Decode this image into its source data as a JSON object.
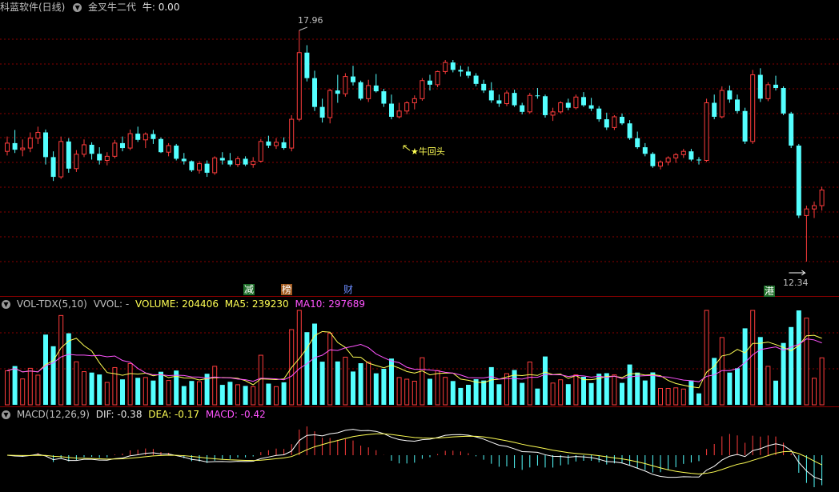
{
  "main_header": {
    "title": "科蓝软件(日线)",
    "indicator": "金叉牛二代",
    "value_text": "牛: 0.00"
  },
  "annotations": {
    "high": "17.96",
    "low": "12.34",
    "signal": "★牛回头"
  },
  "event_tags": [
    {
      "label": "减",
      "color": "#3cb043"
    },
    {
      "label": "榜",
      "color": "#c88040"
    },
    {
      "label": "财",
      "color": "#6c8cff"
    },
    {
      "label": "港",
      "color": "#3cb043"
    }
  ],
  "vol_header": {
    "name": "VOL-TDX(5,10)",
    "vvol": "VVOL: -",
    "volume": "VOLUME: 204406",
    "ma5": "MA5: 239230",
    "ma10": "MA10: 297689"
  },
  "macd_header": {
    "name": "MACD(12,26,9)",
    "dif": "DIF: -0.38",
    "dea": "DEA: -0.17",
    "macd": "MACD: -0.42"
  },
  "colors": {
    "up": "#ff3c3c",
    "down": "#54ffff",
    "grid": "#8a0000",
    "yellow": "#ffff54",
    "magenta": "#ff54ff",
    "white": "#ffffff"
  },
  "chart_data": {
    "type": "candlestick",
    "price_range": [
      12.34,
      17.96
    ],
    "candles": [
      [
        15.02,
        15.38,
        14.92,
        15.22
      ],
      [
        15.22,
        15.54,
        14.98,
        15.06
      ],
      [
        15.06,
        15.31,
        14.9,
        15.1
      ],
      [
        15.1,
        15.48,
        15.0,
        15.34
      ],
      [
        15.34,
        15.62,
        15.2,
        15.48
      ],
      [
        15.48,
        15.55,
        14.7,
        14.88
      ],
      [
        14.88,
        15.02,
        14.3,
        14.4
      ],
      [
        14.4,
        15.38,
        14.35,
        15.26
      ],
      [
        15.26,
        15.34,
        14.5,
        14.6
      ],
      [
        14.6,
        15.05,
        14.52,
        14.95
      ],
      [
        14.95,
        15.31,
        14.88,
        15.18
      ],
      [
        15.18,
        15.24,
        14.82,
        14.96
      ],
      [
        14.96,
        15.12,
        14.7,
        14.8
      ],
      [
        14.8,
        15.0,
        14.68,
        14.9
      ],
      [
        14.9,
        15.3,
        14.85,
        15.22
      ],
      [
        15.22,
        15.38,
        15.02,
        15.1
      ],
      [
        15.1,
        15.55,
        15.05,
        15.45
      ],
      [
        15.45,
        15.62,
        15.25,
        15.3
      ],
      [
        15.3,
        15.48,
        15.1,
        15.44
      ],
      [
        15.44,
        15.54,
        15.2,
        15.32
      ],
      [
        15.32,
        15.36,
        14.98,
        15.0
      ],
      [
        15.0,
        15.22,
        14.9,
        15.16
      ],
      [
        15.16,
        15.2,
        14.8,
        14.84
      ],
      [
        14.84,
        14.98,
        14.7,
        14.78
      ],
      [
        14.78,
        14.8,
        14.52,
        14.56
      ],
      [
        14.56,
        14.78,
        14.48,
        14.72
      ],
      [
        14.72,
        14.8,
        14.4,
        14.5
      ],
      [
        14.5,
        14.9,
        14.45,
        14.86
      ],
      [
        14.86,
        15.0,
        14.7,
        14.8
      ],
      [
        14.8,
        14.98,
        14.65,
        14.7
      ],
      [
        14.7,
        14.9,
        14.64,
        14.84
      ],
      [
        14.84,
        14.9,
        14.66,
        14.7
      ],
      [
        14.7,
        14.88,
        14.62,
        14.78
      ],
      [
        14.78,
        15.32,
        14.75,
        15.26
      ],
      [
        15.26,
        15.4,
        15.1,
        15.16
      ],
      [
        15.16,
        15.34,
        15.08,
        15.24
      ],
      [
        15.24,
        15.36,
        15.06,
        15.1
      ],
      [
        15.1,
        15.9,
        15.02,
        15.8
      ],
      [
        15.8,
        17.96,
        15.75,
        17.42
      ],
      [
        17.42,
        17.6,
        16.72,
        16.8
      ],
      [
        16.8,
        16.98,
        16.0,
        16.1
      ],
      [
        16.1,
        16.3,
        15.72,
        15.84
      ],
      [
        15.84,
        16.54,
        15.7,
        16.5
      ],
      [
        16.5,
        16.88,
        16.2,
        16.42
      ],
      [
        16.42,
        16.92,
        16.35,
        16.84
      ],
      [
        16.84,
        17.1,
        16.62,
        16.7
      ],
      [
        16.7,
        16.74,
        16.26,
        16.3
      ],
      [
        16.3,
        16.76,
        16.22,
        16.62
      ],
      [
        16.62,
        16.9,
        16.45,
        16.48
      ],
      [
        16.48,
        16.54,
        16.1,
        16.18
      ],
      [
        16.18,
        16.4,
        15.8,
        15.86
      ],
      [
        15.86,
        16.2,
        15.82,
        16.0
      ],
      [
        16.0,
        16.24,
        15.92,
        16.2
      ],
      [
        16.2,
        16.38,
        16.04,
        16.3
      ],
      [
        16.3,
        16.8,
        16.25,
        16.74
      ],
      [
        16.74,
        16.88,
        16.5,
        16.64
      ],
      [
        16.64,
        16.98,
        16.58,
        16.96
      ],
      [
        16.96,
        17.24,
        16.9,
        17.18
      ],
      [
        17.18,
        17.24,
        16.94,
        17.0
      ],
      [
        17.0,
        17.1,
        16.84,
        16.96
      ],
      [
        16.96,
        17.08,
        16.8,
        16.86
      ],
      [
        16.86,
        16.92,
        16.6,
        16.66
      ],
      [
        16.66,
        16.76,
        16.44,
        16.5
      ],
      [
        16.5,
        16.7,
        16.2,
        16.26
      ],
      [
        16.26,
        16.4,
        16.1,
        16.18
      ],
      [
        16.18,
        16.5,
        16.12,
        16.44
      ],
      [
        16.44,
        16.52,
        16.1,
        16.14
      ],
      [
        16.14,
        16.2,
        15.92,
        15.98
      ],
      [
        15.98,
        16.44,
        15.94,
        16.38
      ],
      [
        16.38,
        16.56,
        16.3,
        16.36
      ],
      [
        16.36,
        16.4,
        15.84,
        15.9
      ],
      [
        15.9,
        16.08,
        15.76,
        15.98
      ],
      [
        15.98,
        16.24,
        15.94,
        16.2
      ],
      [
        16.2,
        16.3,
        16.02,
        16.08
      ],
      [
        16.08,
        16.4,
        16.04,
        16.34
      ],
      [
        16.34,
        16.46,
        16.1,
        16.14
      ],
      [
        16.14,
        16.32,
        16.0,
        16.06
      ],
      [
        16.06,
        16.12,
        15.74,
        15.8
      ],
      [
        15.8,
        15.96,
        15.54,
        15.6
      ],
      [
        15.6,
        15.9,
        15.54,
        15.86
      ],
      [
        15.86,
        15.94,
        15.66,
        15.7
      ],
      [
        15.7,
        15.78,
        15.3,
        15.34
      ],
      [
        15.34,
        15.5,
        15.08,
        15.12
      ],
      [
        15.12,
        15.22,
        14.9,
        14.96
      ],
      [
        14.96,
        15.0,
        14.62,
        14.66
      ],
      [
        14.66,
        14.8,
        14.58,
        14.76
      ],
      [
        14.76,
        14.9,
        14.68,
        14.86
      ],
      [
        14.86,
        14.98,
        14.74,
        14.94
      ],
      [
        14.94,
        15.08,
        14.86,
        15.02
      ],
      [
        15.02,
        15.08,
        14.78,
        14.82
      ],
      [
        14.82,
        14.88,
        14.7,
        14.8
      ],
      [
        14.8,
        16.3,
        14.76,
        16.2
      ],
      [
        16.2,
        16.4,
        15.8,
        15.86
      ],
      [
        15.86,
        16.6,
        15.82,
        16.5
      ],
      [
        16.5,
        16.62,
        16.2,
        16.28
      ],
      [
        16.28,
        16.4,
        15.94,
        16.0
      ],
      [
        16.0,
        16.08,
        15.2,
        15.26
      ],
      [
        15.26,
        17.0,
        15.2,
        16.88
      ],
      [
        16.88,
        17.04,
        16.22,
        16.3
      ],
      [
        16.3,
        16.7,
        16.24,
        16.64
      ],
      [
        16.64,
        16.86,
        16.5,
        16.56
      ],
      [
        16.56,
        16.6,
        15.9,
        15.94
      ],
      [
        15.94,
        15.98,
        15.1,
        15.16
      ],
      [
        15.16,
        15.2,
        13.4,
        13.46
      ],
      [
        13.46,
        13.7,
        12.34,
        13.62
      ],
      [
        13.62,
        13.8,
        13.4,
        13.7
      ],
      [
        13.7,
        14.16,
        13.58,
        14.08
      ]
    ],
    "volume": [],
    "ma5": [],
    "ma10": [],
    "dif": [],
    "dea": [],
    "macd": []
  }
}
